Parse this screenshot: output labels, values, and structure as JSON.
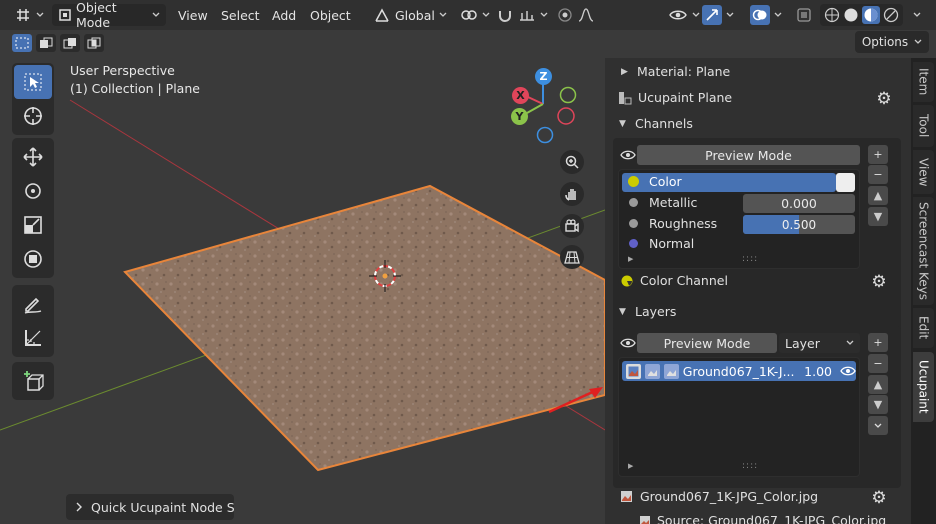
{
  "header": {
    "mode_label": "Object Mode",
    "menu": [
      "View",
      "Select",
      "Add",
      "Object"
    ],
    "orientation_label": "Global",
    "options_label": "Options"
  },
  "viewport": {
    "perspective_label": "User Perspective",
    "collection_label": "(1) Collection | Plane",
    "popup_label": "Quick Ucupaint Node Setu",
    "gizmo": {
      "x": "X",
      "y": "Y",
      "z": "Z"
    },
    "gizmo_colors": {
      "x": "#e0455a",
      "y": "#8bc34a",
      "z": "#3d8fe0"
    }
  },
  "npanel": {
    "material_label": "Material: Plane",
    "ucupaint_label": "Ucupaint Plane",
    "channels_label": "Channels",
    "channels_preview_label": "Preview Mode",
    "channels": [
      {
        "name": "Color",
        "value": "",
        "dot": "#cccc00"
      },
      {
        "name": "Metallic",
        "value": "0.000",
        "dot": "#9a9a9a"
      },
      {
        "name": "Roughness",
        "value": "0.500",
        "dot": "#9a9a9a"
      },
      {
        "name": "Normal",
        "value": "",
        "dot": "#6060c8"
      }
    ],
    "color_channel_label": "Color Channel",
    "layers_label": "Layers",
    "layers_preview_label": "Preview Mode",
    "layers_dropdown_label": "Layer",
    "layer_item": {
      "name": "Ground067_1K-J...",
      "opacity": "1.00"
    },
    "image_label": "Ground067_1K-JPG_Color.jpg",
    "source_label": "Source: Ground067_1K-JPG_Color.jpg"
  },
  "tabs": [
    "Item",
    "Tool",
    "View",
    "Screencast Keys",
    "Edit",
    "Ucupaint"
  ],
  "accent_color": "#4772b3",
  "selection_color": "#e8853a"
}
